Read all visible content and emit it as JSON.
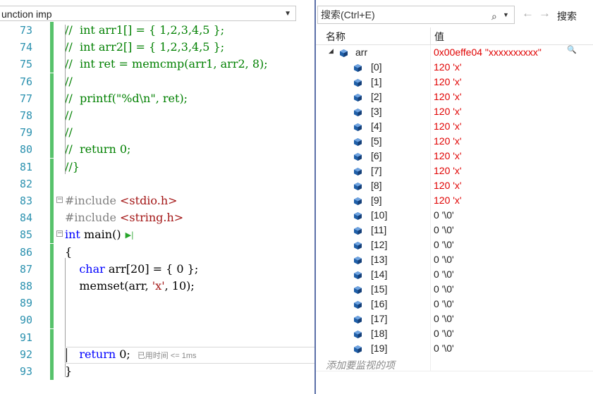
{
  "editor": {
    "nav_text": "unction imp",
    "lines": [
      {
        "n": "73",
        "code": "//  int arr1[] = { 1,2,3,4,5 };",
        "cls": "cm"
      },
      {
        "n": "74",
        "code": "//  int arr2[] = { 1,2,3,4,5 };",
        "cls": "cm"
      },
      {
        "n": "75",
        "code": "//  int ret = memcmp(arr1, arr2, 8);",
        "cls": "cm"
      },
      {
        "n": "76",
        "code": "//",
        "cls": "cm"
      },
      {
        "n": "77",
        "code": "//  printf(\"%d\\n\", ret);",
        "cls": "cm"
      },
      {
        "n": "78",
        "code": "//",
        "cls": "cm"
      },
      {
        "n": "79",
        "code": "//",
        "cls": "cm"
      },
      {
        "n": "80",
        "code": "//  return 0;",
        "cls": "cm"
      },
      {
        "n": "81",
        "code": "//}",
        "cls": "cm"
      },
      {
        "n": "82",
        "code": "",
        "cls": ""
      },
      {
        "n": "83",
        "code": "#include <stdio.h>",
        "cls": "pp"
      },
      {
        "n": "84",
        "code": "#include <string.h>",
        "cls": "pp"
      },
      {
        "n": "85",
        "code": "int main()",
        "cls": "main"
      },
      {
        "n": "86",
        "code": "{",
        "cls": ""
      },
      {
        "n": "87",
        "code": "    char arr[20] = { 0 };",
        "cls": "char"
      },
      {
        "n": "88",
        "code": "    memset(arr, 'x', 10);",
        "cls": "memset"
      },
      {
        "n": "89",
        "code": "",
        "cls": ""
      },
      {
        "n": "90",
        "code": "",
        "cls": ""
      },
      {
        "n": "91",
        "code": "",
        "cls": ""
      },
      {
        "n": "92",
        "code": "    return 0;",
        "cls": "ret"
      },
      {
        "n": "93",
        "code": "}",
        "cls": ""
      }
    ],
    "elapsed_hint": "已用时间 <= 1ms"
  },
  "watch": {
    "search_placeholder": "搜索(Ctrl+E)",
    "search_depth_label": "搜索",
    "col_name": "名称",
    "col_value": "值",
    "root": {
      "name": "arr",
      "value": "0x00effe04 \"xxxxxxxxxx\""
    },
    "items": [
      {
        "name": "[0]",
        "value": "120 'x'"
      },
      {
        "name": "[1]",
        "value": "120 'x'"
      },
      {
        "name": "[2]",
        "value": "120 'x'"
      },
      {
        "name": "[3]",
        "value": "120 'x'"
      },
      {
        "name": "[4]",
        "value": "120 'x'"
      },
      {
        "name": "[5]",
        "value": "120 'x'"
      },
      {
        "name": "[6]",
        "value": "120 'x'"
      },
      {
        "name": "[7]",
        "value": "120 'x'"
      },
      {
        "name": "[8]",
        "value": "120 'x'"
      },
      {
        "name": "[9]",
        "value": "120 'x'"
      },
      {
        "name": "[10]",
        "value": "0 '\\0'"
      },
      {
        "name": "[11]",
        "value": "0 '\\0'"
      },
      {
        "name": "[12]",
        "value": "0 '\\0'"
      },
      {
        "name": "[13]",
        "value": "0 '\\0'"
      },
      {
        "name": "[14]",
        "value": "0 '\\0'"
      },
      {
        "name": "[15]",
        "value": "0 '\\0'"
      },
      {
        "name": "[16]",
        "value": "0 '\\0'"
      },
      {
        "name": "[17]",
        "value": "0 '\\0'"
      },
      {
        "name": "[18]",
        "value": "0 '\\0'"
      },
      {
        "name": "[19]",
        "value": "0 '\\0'"
      }
    ],
    "add_watch_label": "添加要监视的项",
    "colors": {
      "changed": "#e00000",
      "normal": "#1e1e1e",
      "cube": "#1f5fa8"
    }
  }
}
